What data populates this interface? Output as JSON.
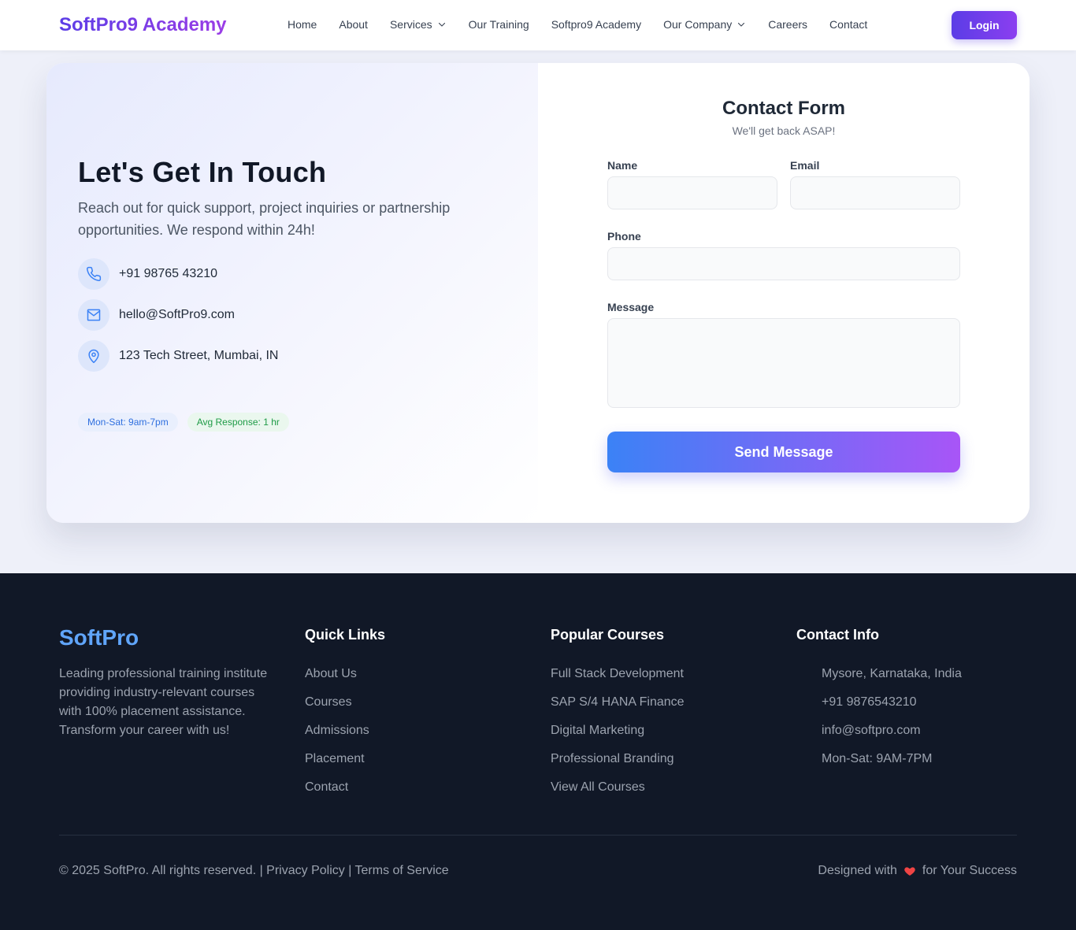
{
  "nav": {
    "brand": "SoftPro9 Academy",
    "items": [
      {
        "label": "Home",
        "dropdown": false
      },
      {
        "label": "About",
        "dropdown": false
      },
      {
        "label": "Services",
        "dropdown": true
      },
      {
        "label": "Our Training",
        "dropdown": false
      },
      {
        "label": "Softpro9 Academy",
        "dropdown": false
      },
      {
        "label": "Our Company",
        "dropdown": true
      },
      {
        "label": "Careers",
        "dropdown": false
      },
      {
        "label": "Contact",
        "dropdown": false
      }
    ],
    "login_label": "Login"
  },
  "hero": {
    "title": "Let's Get In Touch",
    "lead": "Reach out for quick support, project inquiries or partnership opportunities. We respond within 24h!",
    "phone": "+91 98765 43210",
    "email": "hello@SoftPro9.com",
    "address": "123 Tech Street, Mumbai, IN",
    "badge_hours": "Mon-Sat: 9am-7pm",
    "badge_response": "Avg Response: 1 hr"
  },
  "form": {
    "title": "Contact Form",
    "subtitle": "We'll get back ASAP!",
    "name_label": "Name",
    "email_label": "Email",
    "phone_label": "Phone",
    "message_label": "Message",
    "name_value": "",
    "email_value": "",
    "phone_value": "",
    "message_value": "",
    "submit_label": "Send Message"
  },
  "footer": {
    "brand": "SoftPro",
    "description": "Leading professional training institute providing industry-relevant courses with 100% placement assistance. Transform your career with us!",
    "quick_links_title": "Quick Links",
    "quick_links": [
      "About Us",
      "Courses",
      "Admissions",
      "Placement",
      "Contact"
    ],
    "courses_title": "Popular Courses",
    "courses": [
      "Full Stack Development",
      "SAP S/4 HANA Finance",
      "Digital Marketing",
      "Professional Branding",
      "View All Courses"
    ],
    "contact_title": "Contact Info",
    "contact": [
      "Mysore, Karnataka, India",
      "+91 9876543210",
      "info@softpro.com",
      "Mon-Sat: 9AM-7PM"
    ],
    "copyright": "© 2025 SoftPro. All rights reserved. | Privacy Policy | Terms of Service",
    "made_prefix": "Designed with",
    "made_suffix": "for Your Success"
  },
  "colors": {
    "accent": "#5b3de6",
    "link_blue": "#3b82f6",
    "footer_bg": "#111827",
    "heart": "#ef4444"
  }
}
